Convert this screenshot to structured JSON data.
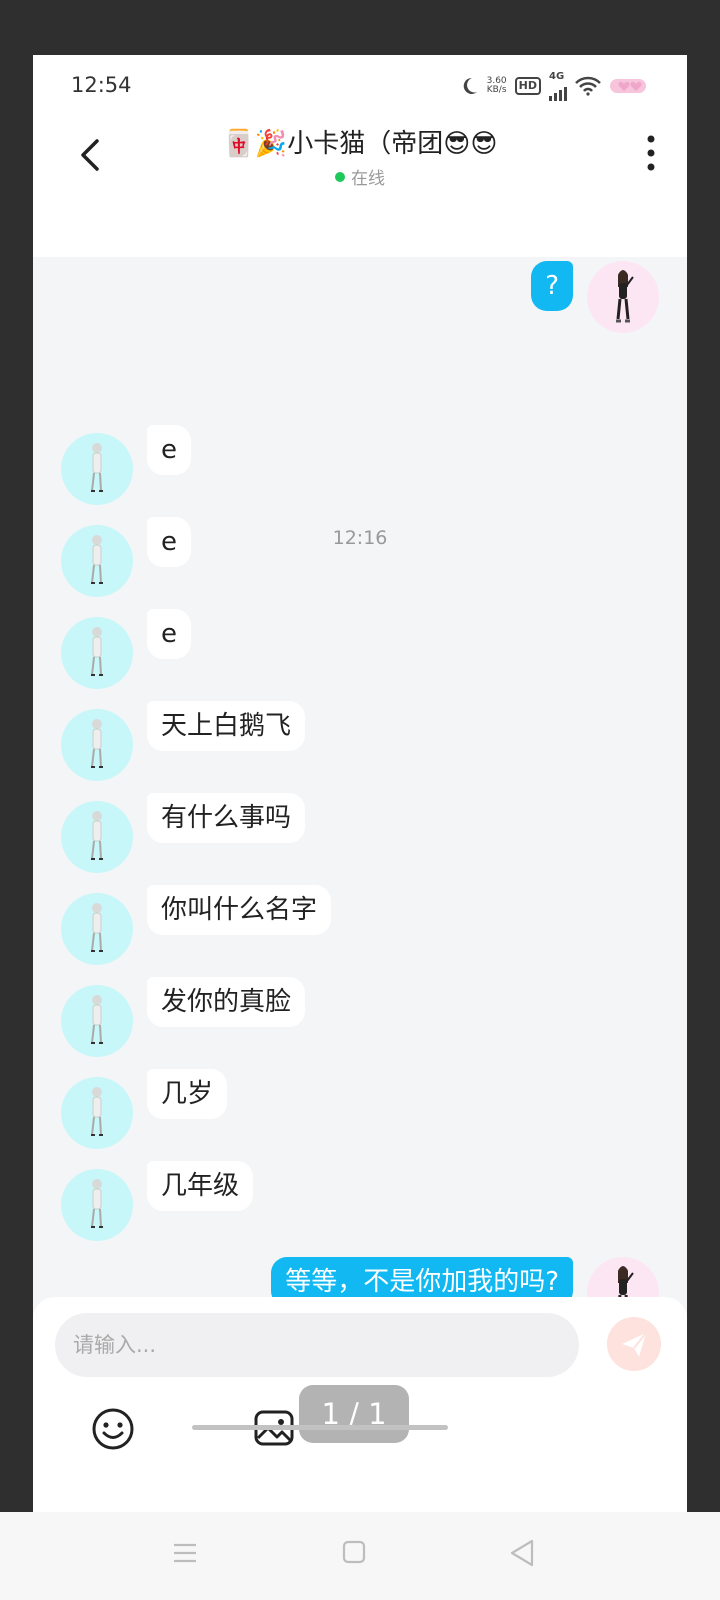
{
  "status_bar": {
    "time": "12:54",
    "net_speed_value": "3.60",
    "net_speed_unit": "KB/s",
    "hd_label": "HD",
    "network_label": "4G",
    "icons": [
      "moon-icon",
      "hd-icon",
      "signal-icon",
      "wifi-icon",
      "battery-icon"
    ]
  },
  "header": {
    "title": "🀄🎉小卡猫（帝团😎😎",
    "status": "在线",
    "status_color": "#1ec85a",
    "back_icon": "chevron-left-icon",
    "more_icon": "more-vertical-icon"
  },
  "chat": {
    "timestamp": "12:16",
    "messages": [
      {
        "sender": "me",
        "text": "?"
      },
      {
        "sender": "them",
        "text": "e"
      },
      {
        "sender": "them",
        "text": "e"
      },
      {
        "sender": "them",
        "text": "e"
      },
      {
        "sender": "them",
        "text": "天上白鹅飞"
      },
      {
        "sender": "them",
        "text": "有什么事吗"
      },
      {
        "sender": "them",
        "text": "你叫什么名字"
      },
      {
        "sender": "them",
        "text": "发你的真脸"
      },
      {
        "sender": "them",
        "text": "几岁"
      },
      {
        "sender": "them",
        "text": "几年级"
      },
      {
        "sender": "me",
        "text": "等等，不是你加我的吗?"
      }
    ]
  },
  "input": {
    "placeholder": "请输入...",
    "value": "",
    "send_icon": "send-icon",
    "emoji_icon": "emoji-icon",
    "image_icon": "image-icon"
  },
  "pager": {
    "text": "1 / 1"
  },
  "colors": {
    "my_bubble": "#11b8f2",
    "their_avatar_bg": "#c7f7f8",
    "my_avatar_bg": "#fde6f4"
  },
  "nav_bar": {
    "icons": [
      "menu-icon",
      "home-icon",
      "back-triangle-icon"
    ]
  }
}
